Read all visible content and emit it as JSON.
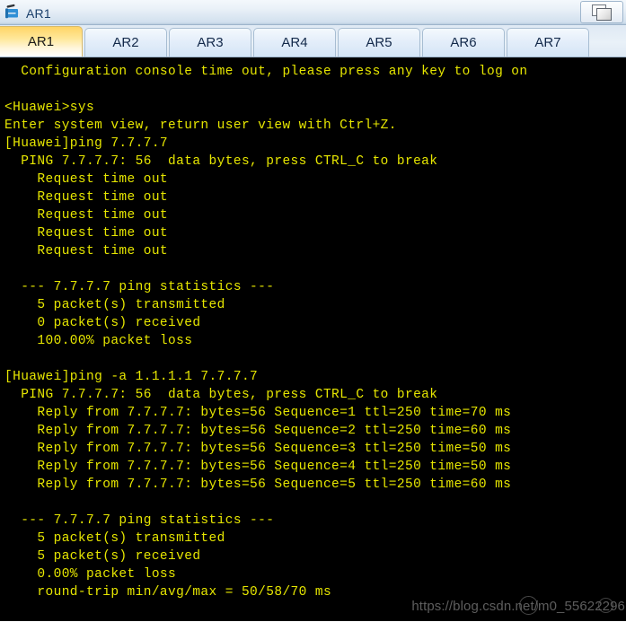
{
  "window": {
    "title": "AR1",
    "icon": "router-device-icon",
    "restore_button_icon": "restore-window-icon"
  },
  "tabs": [
    {
      "label": "AR1",
      "active": true
    },
    {
      "label": "AR2",
      "active": false
    },
    {
      "label": "AR3",
      "active": false
    },
    {
      "label": "AR4",
      "active": false
    },
    {
      "label": "AR5",
      "active": false
    },
    {
      "label": "AR6",
      "active": false
    },
    {
      "label": "AR7",
      "active": false
    }
  ],
  "terminal": {
    "foreground_color": "#e6e600",
    "background_color": "#000000",
    "lines": [
      "  Configuration console time out, please press any key to log on",
      "",
      "<Huawei>sys",
      "Enter system view, return user view with Ctrl+Z.",
      "[Huawei]ping 7.7.7.7",
      "  PING 7.7.7.7: 56  data bytes, press CTRL_C to break",
      "    Request time out",
      "    Request time out",
      "    Request time out",
      "    Request time out",
      "    Request time out",
      "",
      "  --- 7.7.7.7 ping statistics ---",
      "    5 packet(s) transmitted",
      "    0 packet(s) received",
      "    100.00% packet loss",
      "",
      "[Huawei]ping -a 1.1.1.1 7.7.7.7",
      "  PING 7.7.7.7: 56  data bytes, press CTRL_C to break",
      "    Reply from 7.7.7.7: bytes=56 Sequence=1 ttl=250 time=70 ms",
      "    Reply from 7.7.7.7: bytes=56 Sequence=2 ttl=250 time=60 ms",
      "    Reply from 7.7.7.7: bytes=56 Sequence=3 ttl=250 time=50 ms",
      "    Reply from 7.7.7.7: bytes=56 Sequence=4 ttl=250 time=50 ms",
      "    Reply from 7.7.7.7: bytes=56 Sequence=5 ttl=250 time=60 ms",
      "",
      "  --- 7.7.7.7 ping statistics ---",
      "    5 packet(s) transmitted",
      "    5 packet(s) received",
      "    0.00% packet loss",
      "    round-trip min/avg/max = 50/58/70 ms"
    ]
  },
  "watermark": {
    "text": "https://blog.csdn.net/m0_55622296"
  }
}
